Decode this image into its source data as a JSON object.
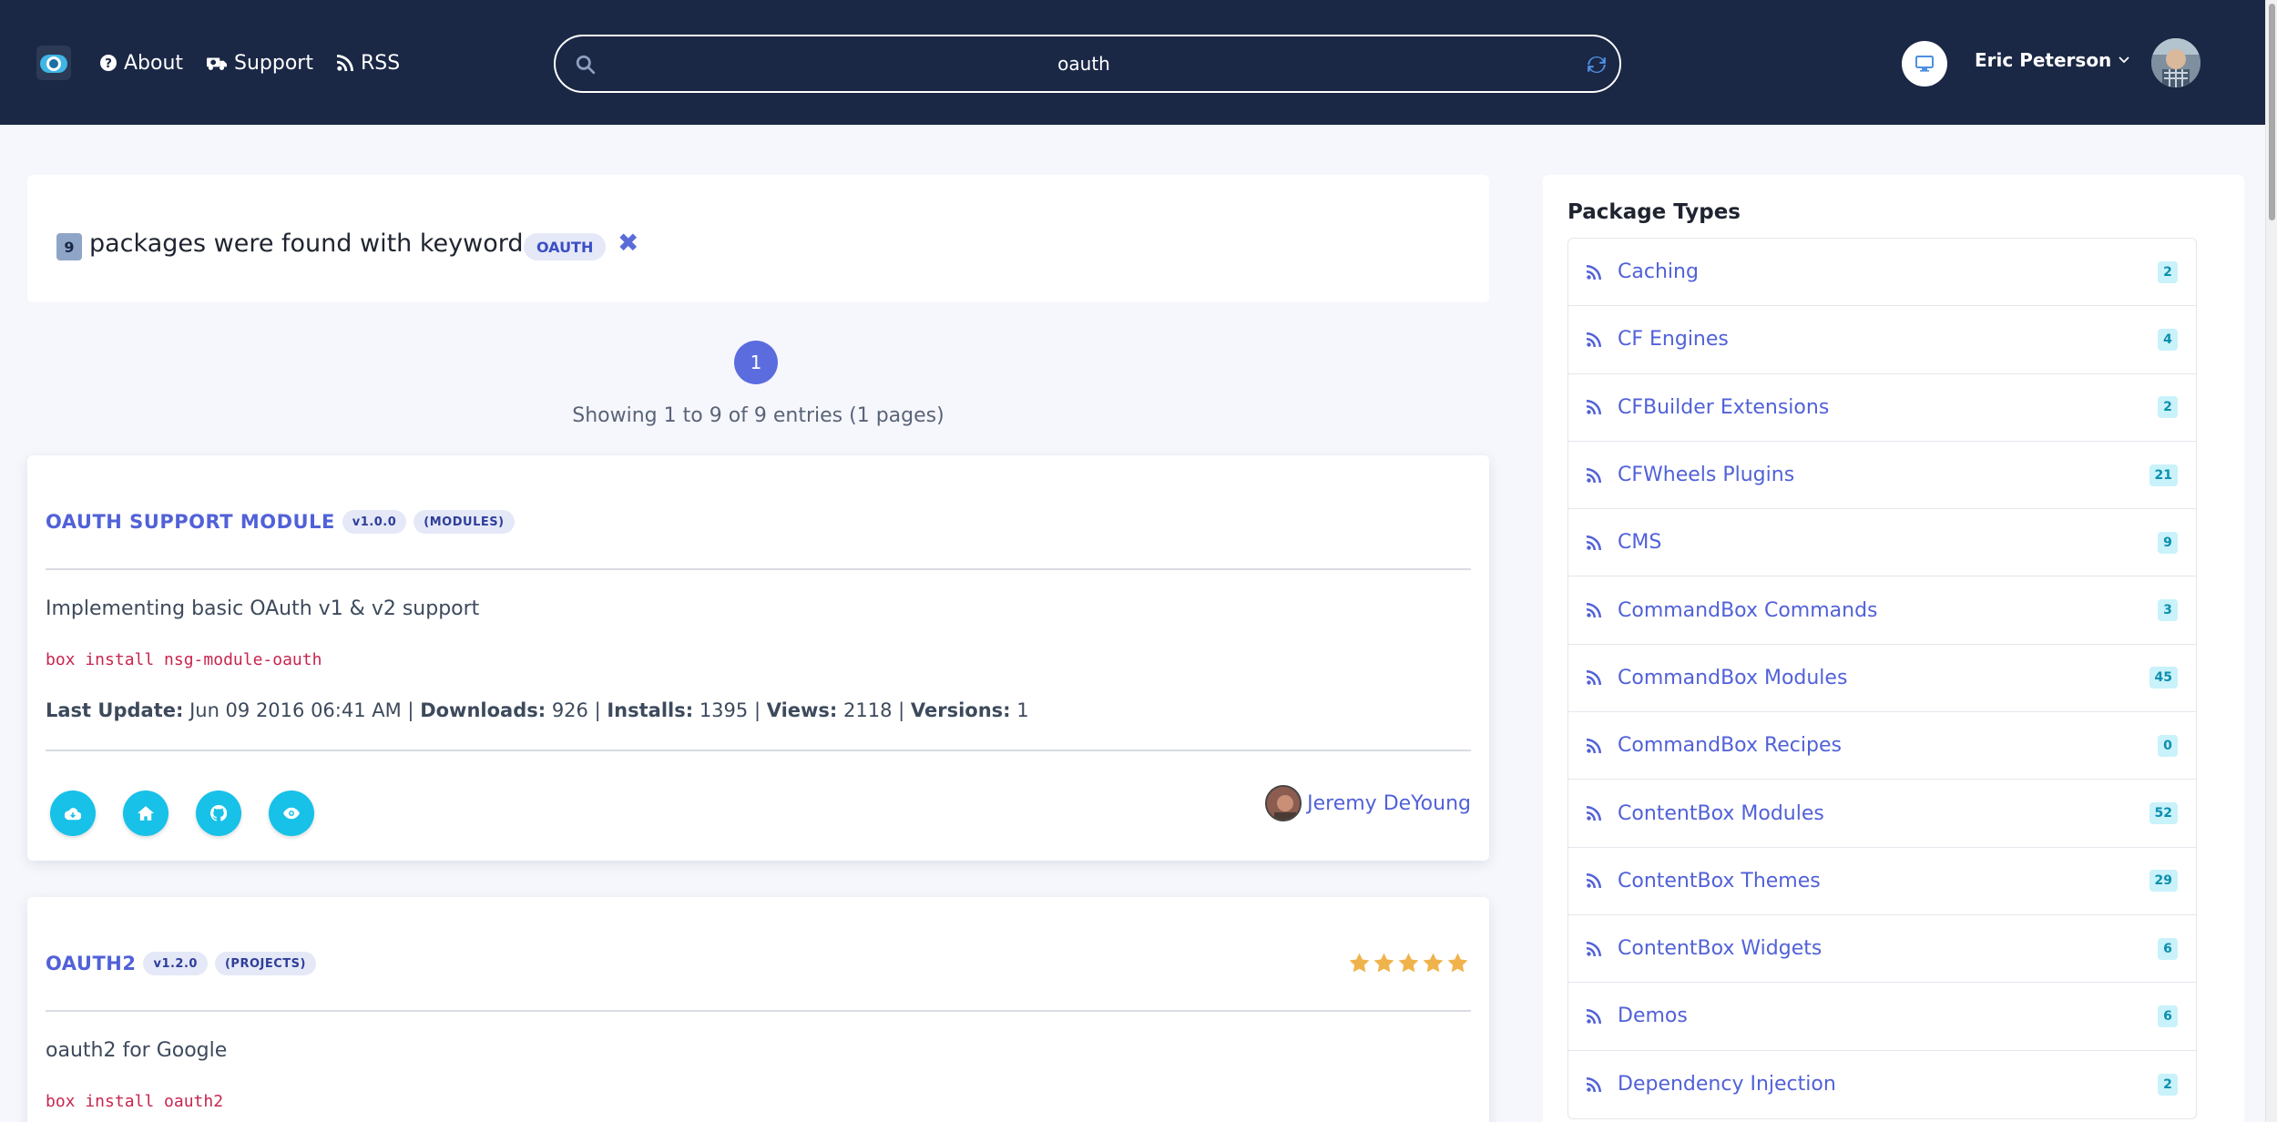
{
  "nav": {
    "about": "About",
    "support": "Support",
    "rss": "RSS",
    "search_value": "oauth",
    "user_name": "Eric Peterson"
  },
  "results": {
    "count": "9",
    "text": "packages were found with keyword:",
    "keyword": "OAUTH",
    "page": "1",
    "showing": "Showing 1 to 9 of 9 entries (1 pages)"
  },
  "packages": [
    {
      "title": "OAUTH SUPPORT MODULE",
      "version": "v1.0.0",
      "type": "(MODULES)",
      "description": "Implementing basic OAuth v1 & v2 support",
      "install": "box install nsg-module-oauth",
      "meta": {
        "last_update_label": "Last Update:",
        "last_update": "Jun 09 2016 06:41 AM",
        "downloads_label": "Downloads:",
        "downloads": "926",
        "installs_label": "Installs:",
        "installs": "1395",
        "views_label": "Views:",
        "views": "2118",
        "versions_label": "Versions:",
        "versions": "1"
      },
      "author": "Jeremy DeYoung"
    },
    {
      "title": "OAUTH2",
      "version": "v1.2.0",
      "type": "(PROJECTS)",
      "rating": 5,
      "description": "oauth2 for Google",
      "install": "box install oauth2"
    }
  ],
  "sidebar": {
    "title": "Package Types",
    "items": [
      {
        "label": "Caching",
        "count": "2"
      },
      {
        "label": "CF Engines",
        "count": "4"
      },
      {
        "label": "CFBuilder Extensions",
        "count": "2"
      },
      {
        "label": "CFWheels Plugins",
        "count": "21"
      },
      {
        "label": "CMS",
        "count": "9"
      },
      {
        "label": "CommandBox Commands",
        "count": "3"
      },
      {
        "label": "CommandBox Modules",
        "count": "45"
      },
      {
        "label": "CommandBox Recipes",
        "count": "0"
      },
      {
        "label": "ContentBox Modules",
        "count": "52"
      },
      {
        "label": "ContentBox Themes",
        "count": "29"
      },
      {
        "label": "ContentBox Widgets",
        "count": "6"
      },
      {
        "label": "Demos",
        "count": "6"
      },
      {
        "label": "Dependency Injection",
        "count": "2"
      }
    ]
  },
  "colors": {
    "navbar": "#1a2745",
    "accent": "#5161d8",
    "action": "#17c1e8",
    "code": "#c7254e",
    "star": "#f0b34b"
  }
}
